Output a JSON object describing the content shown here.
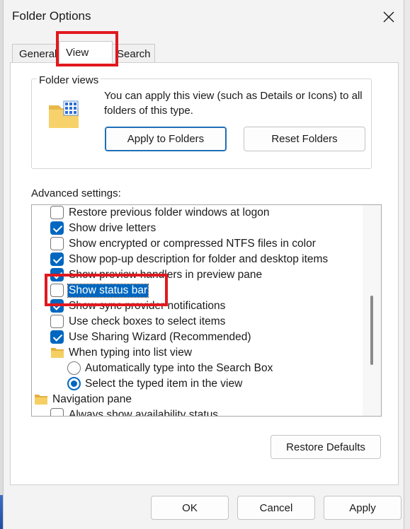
{
  "window": {
    "title": "Folder Options"
  },
  "tabs": [
    {
      "label": "General",
      "active": false
    },
    {
      "label": "View",
      "active": true
    },
    {
      "label": "Search",
      "active": false
    }
  ],
  "folder_views": {
    "label": "Folder views",
    "description": "You can apply this view (such as Details or Icons) to all folders of this type.",
    "apply_button": "Apply to Folders",
    "reset_button": "Reset Folders"
  },
  "advanced": {
    "label": "Advanced settings:",
    "items": [
      {
        "type": "checkbox",
        "label": "Restore previous folder windows at logon",
        "checked": false,
        "level": 1
      },
      {
        "type": "checkbox",
        "label": "Show drive letters",
        "checked": true,
        "level": 1
      },
      {
        "type": "checkbox",
        "label": "Show encrypted or compressed NTFS files in color",
        "checked": false,
        "level": 1
      },
      {
        "type": "checkbox",
        "label": "Show pop-up description for folder and desktop items",
        "checked": true,
        "level": 1
      },
      {
        "type": "checkbox",
        "label": "Show preview handlers in preview pane",
        "checked": true,
        "level": 1
      },
      {
        "type": "checkbox",
        "label": "Show status bar",
        "checked": false,
        "level": 1,
        "selected": true
      },
      {
        "type": "checkbox",
        "label": "Show sync provider notifications",
        "checked": true,
        "level": 1
      },
      {
        "type": "checkbox",
        "label": "Use check boxes to select items",
        "checked": false,
        "level": 1
      },
      {
        "type": "checkbox",
        "label": "Use Sharing Wizard (Recommended)",
        "checked": true,
        "level": 1
      },
      {
        "type": "folder",
        "label": "When typing into list view",
        "level": 1
      },
      {
        "type": "radio",
        "label": "Automatically type into the Search Box",
        "checked": false,
        "level": 2
      },
      {
        "type": "radio",
        "label": "Select the typed item in the view",
        "checked": true,
        "level": 2
      },
      {
        "type": "folder",
        "label": "Navigation pane",
        "level": 0
      },
      {
        "type": "checkbox",
        "label": "Always show availability status",
        "checked": false,
        "level": 1
      }
    ],
    "scroll_position": 0.55
  },
  "buttons": {
    "restore_defaults": "Restore Defaults",
    "ok": "OK",
    "cancel": "Cancel",
    "apply": "Apply"
  },
  "colors": {
    "accent": "#0067c0",
    "annotation": "#e0191f",
    "dialog_bg": "#f3f3f3"
  }
}
